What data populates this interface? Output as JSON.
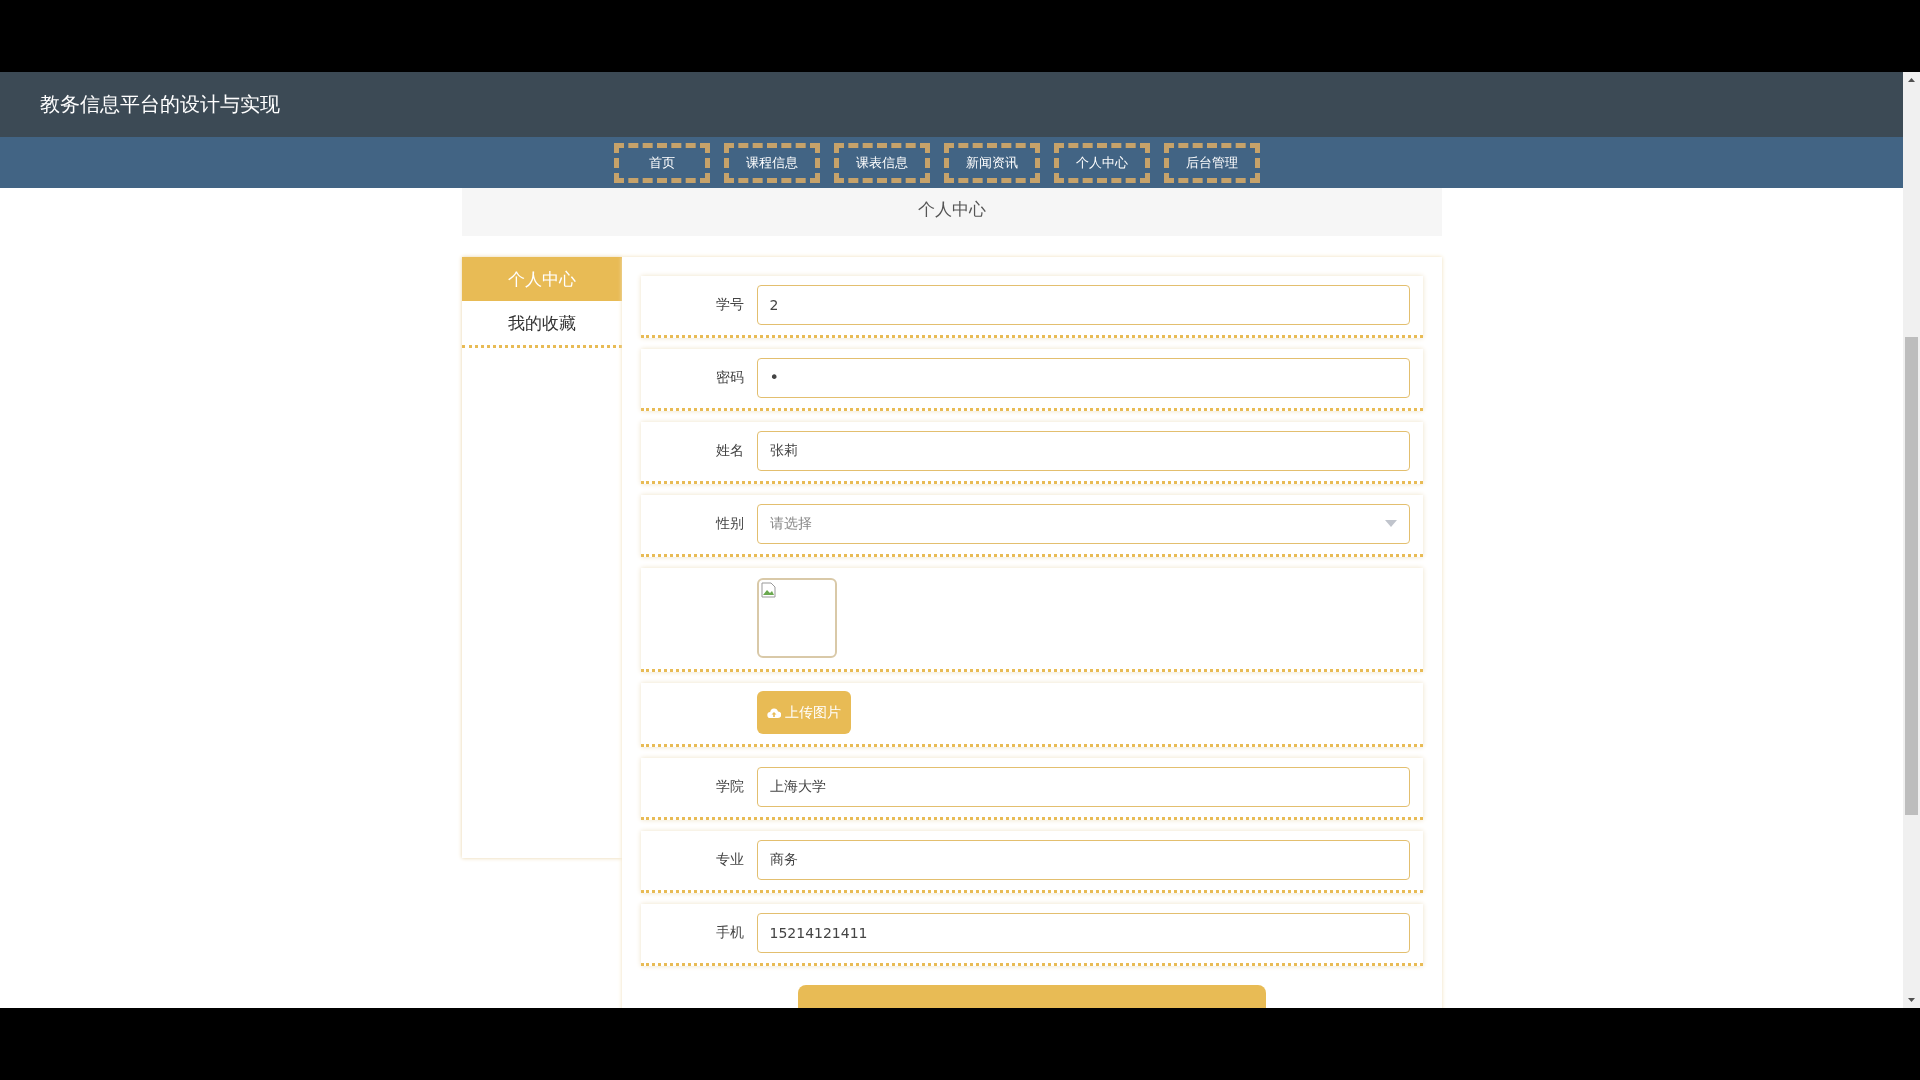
{
  "header": {
    "title": "教务信息平台的设计与实现"
  },
  "nav": [
    {
      "label": "首页"
    },
    {
      "label": "课程信息"
    },
    {
      "label": "课表信息"
    },
    {
      "label": "新闻资讯"
    },
    {
      "label": "个人中心"
    },
    {
      "label": "后台管理"
    }
  ],
  "banner": {
    "title": "个人中心"
  },
  "sidebar": {
    "items": [
      {
        "label": "个人中心",
        "selected": true
      },
      {
        "label": "我的收藏",
        "selected": false
      }
    ]
  },
  "form": {
    "fields": [
      {
        "kind": "text",
        "label": "学号",
        "value": "2"
      },
      {
        "kind": "password",
        "label": "密码",
        "value": "•"
      },
      {
        "kind": "text",
        "label": "姓名",
        "value": "张莉"
      },
      {
        "kind": "select",
        "label": "性别",
        "placeholder": "请选择"
      },
      {
        "kind": "image"
      },
      {
        "kind": "upload",
        "button": "上传图片"
      },
      {
        "kind": "text",
        "label": "学院",
        "value": "上海大学"
      },
      {
        "kind": "text",
        "label": "专业",
        "value": "商务"
      },
      {
        "kind": "text",
        "label": "手机",
        "value": "15214121411"
      }
    ]
  }
}
